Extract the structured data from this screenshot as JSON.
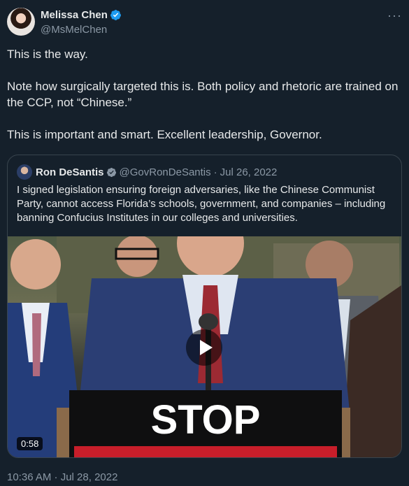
{
  "tweet": {
    "author_name": "Melissa Chen",
    "author_handle": "@MsMelChen",
    "more_label": "···",
    "paragraphs": [
      "This is the way.",
      "Note how surgically targeted this is. Both policy and rhetoric are trained on the CCP, not “Chinese.”",
      "This is important and smart. Excellent leadership, Governor."
    ],
    "timestamp": "10:36 AM · Jul 28, 2022"
  },
  "quoted_tweet": {
    "author_name": "Ron DeSantis",
    "author_handle": "@GovRonDeSantis",
    "separator": "·",
    "date": "Jul 26, 2022",
    "text": "I signed legislation ensuring foreign adversaries, like the Chinese Communist Party, cannot access Florida’s schools, government, and companies – including banning Confucius Institutes in our colleges and universities.",
    "video": {
      "duration": "0:58",
      "podium_sign_text": "STOP"
    }
  },
  "colors": {
    "background": "#15202b",
    "text_primary": "#e7e9ea",
    "text_secondary": "#8b98a5",
    "verified_blue": "#1d9bf0",
    "border": "#38444d"
  },
  "icons": {
    "verified": "verified-badge-icon",
    "more": "more-options-icon",
    "play": "play-icon"
  }
}
